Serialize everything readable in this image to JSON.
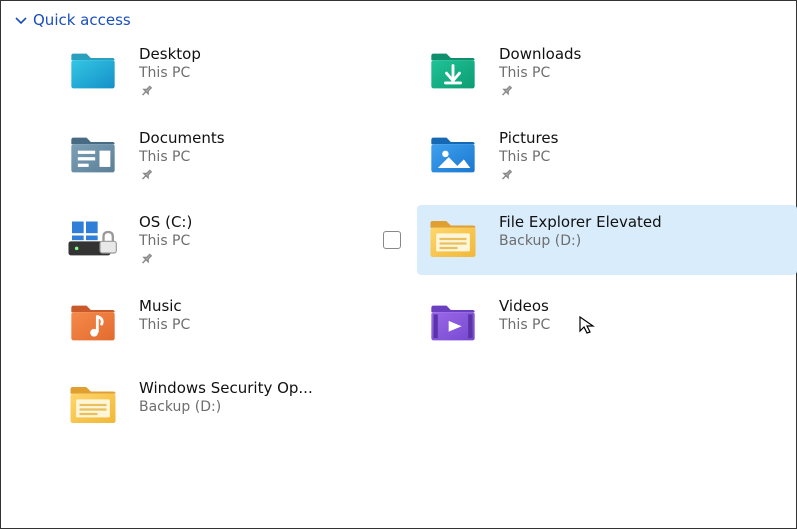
{
  "section": {
    "title": "Quick access"
  },
  "items": [
    {
      "name": "Desktop",
      "sub": "This PC",
      "pinned": true,
      "icon": "desktop",
      "hovered": false
    },
    {
      "name": "Downloads",
      "sub": "This PC",
      "pinned": true,
      "icon": "downloads",
      "hovered": false
    },
    {
      "name": "Documents",
      "sub": "This PC",
      "pinned": true,
      "icon": "documents",
      "hovered": false
    },
    {
      "name": "Pictures",
      "sub": "This PC",
      "pinned": true,
      "icon": "pictures",
      "hovered": false
    },
    {
      "name": "OS (C:)",
      "sub": "This PC",
      "pinned": true,
      "icon": "drive-os",
      "hovered": false
    },
    {
      "name": "File Explorer Elevated",
      "sub": "Backup (D:)",
      "pinned": false,
      "icon": "folder",
      "hovered": true
    },
    {
      "name": "Music",
      "sub": "This PC",
      "pinned": false,
      "icon": "music",
      "hovered": false
    },
    {
      "name": "Videos",
      "sub": "This PC",
      "pinned": false,
      "icon": "videos",
      "hovered": false
    },
    {
      "name": "Windows Security Op...",
      "sub": "Backup (D:)",
      "pinned": false,
      "icon": "folder",
      "hovered": false
    }
  ]
}
